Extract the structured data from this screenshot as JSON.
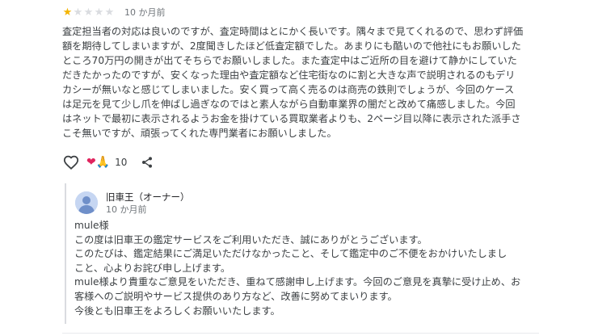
{
  "review": {
    "rating": 1,
    "max_rating": 5,
    "time": "10 か月前",
    "text_lines": [
      "査定担当者の対応は良いのですが、査定時間はとにかく長いです。隅々まで見てくれるので、思わず評価",
      "額を期待してしまいますが、2度聞きしたほど低査定額でした。あまりにも酷いので他社にもお願いした",
      "ところ70万円の開きが出てそちらでお願いしました。また査定中はご近所の目を避けて静かにしていた",
      "だきたかったのですが、安くなった理由や査定額など住宅街なのに割と大きな声で説明されるのもデリ",
      "カシーが無いなと感じてしまいました。安く買って高く売るのは商売の鉄則でしょうが、今回のケース",
      "は足元を見て少し爪を伸ばし過ぎなのではと素人ながら自動車業界の闇だと改めて痛感しました。今回",
      "はネットで最初に表示されるようお金を掛けている買取業者よりも、2ページ目以降に表示された派手さ",
      "こそ無いですが、頑張ってくれた専門業者にお願いしました。"
    ]
  },
  "actions": {
    "like_icon": "heart-outline-icon",
    "share_icon": "share-icon",
    "reaction_emojis": [
      "❤",
      "🙏"
    ],
    "reaction_count": "10"
  },
  "reply": {
    "owner_name": "旧車王（オーナー）",
    "time": "10 か月前",
    "text_lines": [
      "mule様",
      "この度は旧車王の鑑定サービスをご利用いただき、誠にありがとうございます。",
      "このたびは、鑑定結果にご満足いただけなかったこと、そして鑑定中のご不便をおかけいたしまし",
      "こと、心よりお詫び申し上げます。",
      "mule様より貴重なご意見をいただき、重ねて感謝申し上げます。今回のご意見を真摯に受け止め、お",
      "客様へのご説明やサービス提供のあり方など、改善に努めてまいります。",
      "今後とも旧車王をよろしくお願いいたします。"
    ]
  },
  "colors": {
    "star_on": "#f4b400",
    "star_off": "#dadce0",
    "text": "#3c4043",
    "muted": "#70757a",
    "reply_bar": "#dadce0"
  }
}
